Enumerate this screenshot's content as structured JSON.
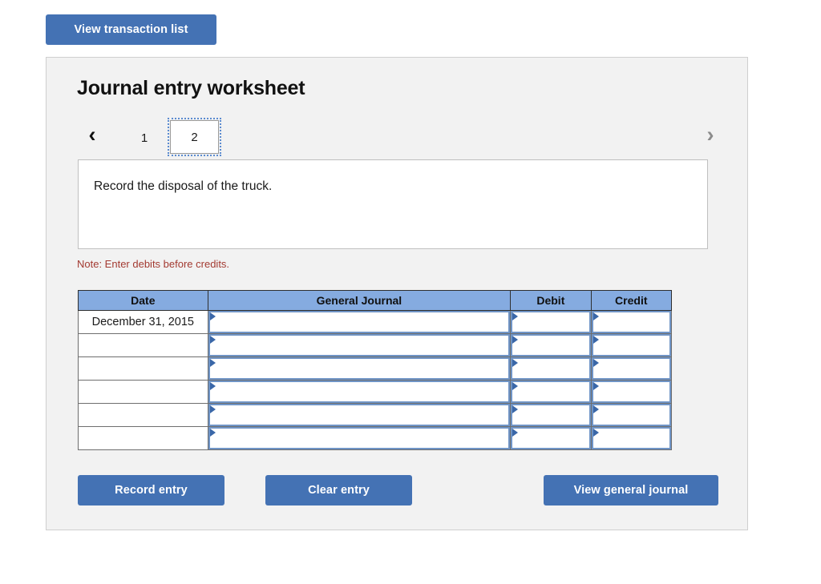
{
  "toolbar": {
    "view_transaction_list_label": "View transaction list"
  },
  "panel": {
    "title": "Journal entry worksheet",
    "pager": {
      "prev_icon": "chevron-left-icon",
      "next_icon": "chevron-right-icon",
      "prev_glyph": "‹",
      "next_glyph": "›",
      "tabs": [
        {
          "label": "1",
          "active": false
        },
        {
          "label": "2",
          "active": true
        }
      ]
    },
    "prompt": {
      "text": "Record the disposal of the truck."
    },
    "note": "Note: Enter debits before credits.",
    "table": {
      "headers": [
        "Date",
        "General Journal",
        "Debit",
        "Credit"
      ],
      "rows": [
        {
          "date": "December 31, 2015",
          "general_journal": "",
          "debit": "",
          "credit": ""
        },
        {
          "date": "",
          "general_journal": "",
          "debit": "",
          "credit": ""
        },
        {
          "date": "",
          "general_journal": "",
          "debit": "",
          "credit": ""
        },
        {
          "date": "",
          "general_journal": "",
          "debit": "",
          "credit": ""
        },
        {
          "date": "",
          "general_journal": "",
          "debit": "",
          "credit": ""
        },
        {
          "date": "",
          "general_journal": "",
          "debit": "",
          "credit": ""
        }
      ]
    },
    "actions": {
      "record_entry_label": "Record entry",
      "clear_entry_label": "Clear entry",
      "view_general_journal_label": "View general journal"
    }
  },
  "colors": {
    "button_blue": "#4472b4",
    "table_header_blue": "#85abe0",
    "field_border_blue": "#6f94c6",
    "field_marker_blue": "#3a67a8",
    "note_red": "#a33a31",
    "panel_background": "#f2f2f2",
    "panel_border": "#cfcfcf"
  }
}
